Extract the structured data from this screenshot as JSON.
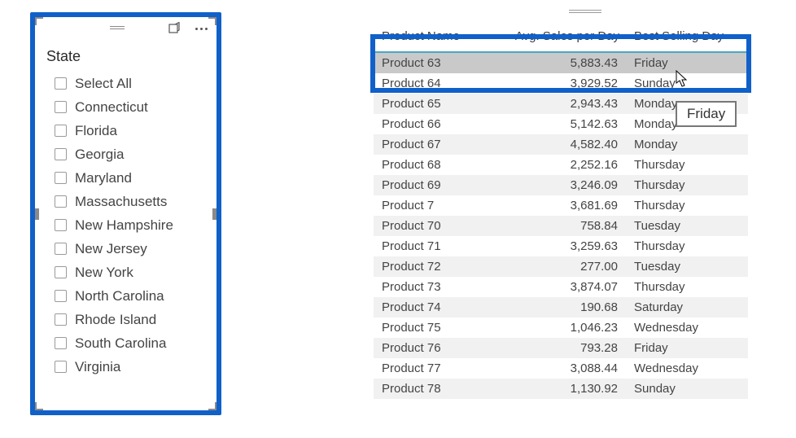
{
  "slicer": {
    "title": "State",
    "items": [
      "Select All",
      "Connecticut",
      "Florida",
      "Georgia",
      "Maryland",
      "Massachusetts",
      "New Hampshire",
      "New Jersey",
      "New York",
      "North Carolina",
      "Rhode Island",
      "South Carolina",
      "Virginia"
    ]
  },
  "table": {
    "columns": {
      "product": "Product Name",
      "avg": "Avg. Sales per Day",
      "day": "Best Selling Day"
    },
    "rows": [
      {
        "product": "Product 63",
        "avg": "5,883.43",
        "day": "Friday"
      },
      {
        "product": "Product 64",
        "avg": "3,929.52",
        "day": "Sunday"
      },
      {
        "product": "Product 65",
        "avg": "2,943.43",
        "day": "Monday"
      },
      {
        "product": "Product 66",
        "avg": "5,142.63",
        "day": "Monday"
      },
      {
        "product": "Product 67",
        "avg": "4,582.40",
        "day": "Monday"
      },
      {
        "product": "Product 68",
        "avg": "2,252.16",
        "day": "Thursday"
      },
      {
        "product": "Product 69",
        "avg": "3,246.09",
        "day": "Thursday"
      },
      {
        "product": "Product 7",
        "avg": "3,681.69",
        "day": "Thursday"
      },
      {
        "product": "Product 70",
        "avg": "758.84",
        "day": "Tuesday"
      },
      {
        "product": "Product 71",
        "avg": "3,259.63",
        "day": "Thursday"
      },
      {
        "product": "Product 72",
        "avg": "277.00",
        "day": "Tuesday"
      },
      {
        "product": "Product 73",
        "avg": "3,874.07",
        "day": "Thursday"
      },
      {
        "product": "Product 74",
        "avg": "190.68",
        "day": "Saturday"
      },
      {
        "product": "Product 75",
        "avg": "1,046.23",
        "day": "Wednesday"
      },
      {
        "product": "Product 76",
        "avg": "793.28",
        "day": "Friday"
      },
      {
        "product": "Product 77",
        "avg": "3,088.44",
        "day": "Wednesday"
      },
      {
        "product": "Product 78",
        "avg": "1,130.92",
        "day": "Sunday"
      }
    ]
  },
  "tooltip": "Friday",
  "chart_data": {
    "type": "table",
    "columns": [
      "Product Name",
      "Avg. Sales per Day",
      "Best Selling Day"
    ],
    "rows": [
      [
        "Product 63",
        5883.43,
        "Friday"
      ],
      [
        "Product 64",
        3929.52,
        "Sunday"
      ],
      [
        "Product 65",
        2943.43,
        "Monday"
      ],
      [
        "Product 66",
        5142.63,
        "Monday"
      ],
      [
        "Product 67",
        4582.4,
        "Monday"
      ],
      [
        "Product 68",
        2252.16,
        "Thursday"
      ],
      [
        "Product 69",
        3246.09,
        "Thursday"
      ],
      [
        "Product 7",
        3681.69,
        "Thursday"
      ],
      [
        "Product 70",
        758.84,
        "Tuesday"
      ],
      [
        "Product 71",
        3259.63,
        "Thursday"
      ],
      [
        "Product 72",
        277.0,
        "Tuesday"
      ],
      [
        "Product 73",
        3874.07,
        "Thursday"
      ],
      [
        "Product 74",
        190.68,
        "Saturday"
      ],
      [
        "Product 75",
        1046.23,
        "Wednesday"
      ],
      [
        "Product 76",
        793.28,
        "Friday"
      ],
      [
        "Product 77",
        3088.44,
        "Wednesday"
      ],
      [
        "Product 78",
        1130.92,
        "Sunday"
      ]
    ]
  }
}
